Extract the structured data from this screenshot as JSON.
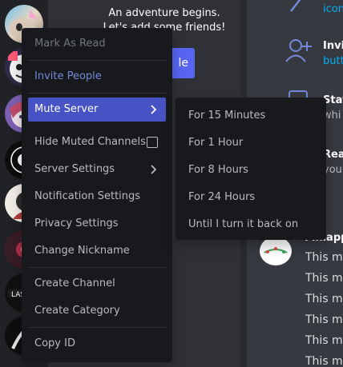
{
  "background": {
    "welcome_line1": "An adventure begins.",
    "welcome_line2": "Let's add some friends!",
    "invite_button_label": "le",
    "tips": [
      {
        "title": "",
        "sub": "icon"
      },
      {
        "title": "Invi",
        "sub": "butt"
      },
      {
        "title": "Stay",
        "sub": "whi"
      },
      {
        "title": "Rea",
        "sub": "you"
      }
    ],
    "message_author": "Finlapp",
    "message_lines": [
      "This me",
      "This me",
      "This me",
      "This me",
      "This me",
      "This me"
    ]
  },
  "context_menu": {
    "items": [
      {
        "label": "Mark As Read",
        "state": "disabled"
      },
      {
        "label": "Invite People",
        "state": "accent"
      },
      {
        "label": "Mute Server",
        "state": "active"
      },
      {
        "label": "Hide Muted Channels",
        "checked": false
      },
      {
        "label": "Server Settings"
      },
      {
        "label": "Notification Settings"
      },
      {
        "label": "Privacy Settings"
      },
      {
        "label": "Change Nickname"
      },
      {
        "label": "Create Channel"
      },
      {
        "label": "Create Category"
      },
      {
        "label": "Copy ID"
      }
    ]
  },
  "mute_submenu": {
    "items": [
      {
        "label": "For 15 Minutes"
      },
      {
        "label": "For 1 Hour"
      },
      {
        "label": "For 8 Hours"
      },
      {
        "label": "For 24 Hours"
      },
      {
        "label": "Until I turn it back on"
      }
    ]
  },
  "colors": {
    "accent": "#7289da",
    "active_bg": "#4752c4",
    "menu_bg": "#18191c",
    "rail_bg": "#202225"
  }
}
